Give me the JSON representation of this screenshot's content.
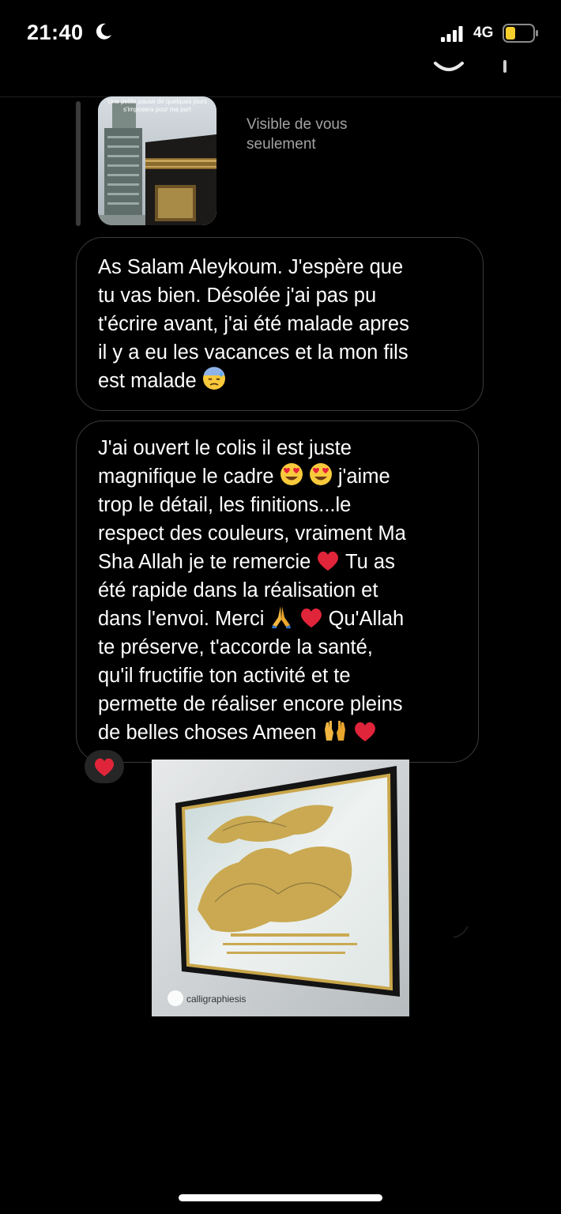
{
  "status_bar": {
    "time": "21:40",
    "network": "4G",
    "battery_level": 0.35,
    "battery_color": "#f6cf2d"
  },
  "story_reply": {
    "thumbnail_caption_line1": "Une petite pause de quelques jours",
    "thumbnail_caption_line2": "s'imposera pour ma part",
    "visibility_note": "Visible de vous seulement"
  },
  "messages": [
    {
      "lines": [
        "As Salam Aleykoum. J'espère que",
        "tu vas bien. Désolée j'ai pas pu",
        "t'écrire avant, j'ai été malade apres",
        "il y a eu les vacances et la mon fils",
        "est malade"
      ],
      "emoji": [
        "downcast-face-with-sweat-icon"
      ]
    },
    {
      "lines": [
        "J'ai ouvert le colis il est juste",
        "magnifique le cadre",
        "j'aime",
        "trop le détail, les finitions...le",
        "respect des couleurs, vraiment Ma",
        "Sha Allah je te remercie",
        "Tu as",
        "été rapide dans la réalisation et",
        "dans l'envoi. Merci",
        "Qu'Allah",
        "te préserve, t'accorde la santé,",
        "qu'il fructifie ton activité et te",
        "permette de réaliser encore pleins",
        "de belles choses Ameen"
      ],
      "reaction": "red-heart-icon"
    }
  ],
  "photo": {
    "watermark": "calligraphiesis"
  },
  "colors": {
    "background": "#000000",
    "bubble_border": "#3b3b3b",
    "muted_text": "#a2a2a2",
    "heart": "#e0243a",
    "gold": "#c9a64a"
  }
}
